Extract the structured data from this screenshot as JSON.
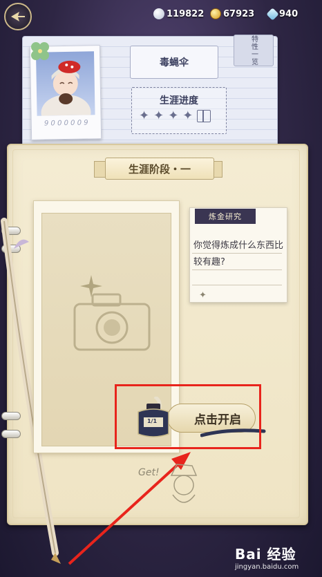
{
  "currencies": [
    {
      "icon": "pearl-icon",
      "value": "119822"
    },
    {
      "icon": "gold-coin-icon",
      "value": "67923"
    },
    {
      "icon": "crystal-icon",
      "value": "940"
    }
  ],
  "top_card": {
    "trait_tab_label": "特性一览",
    "polaroid_caption": "9 0 0 0 0 0 9",
    "character_name": "毒蝇伞",
    "career_progress_title": "生涯进度"
  },
  "notebook": {
    "stage_title": "生涯阶段・一",
    "note_tag": "炼金研究",
    "note_question": "你觉得炼成什么东西比较有趣?",
    "start_button_label": "点击开启",
    "ink_label": "1/1",
    "get_text": "Get!"
  },
  "watermark": {
    "brand": "Bai 经验",
    "url": "jingyan.baidu.com"
  },
  "colors": {
    "highlight": "#e8241c",
    "notebook_bg": "#f4ecd3",
    "card_bg": "#eef1fa",
    "tag_bg": "#3a3552"
  }
}
